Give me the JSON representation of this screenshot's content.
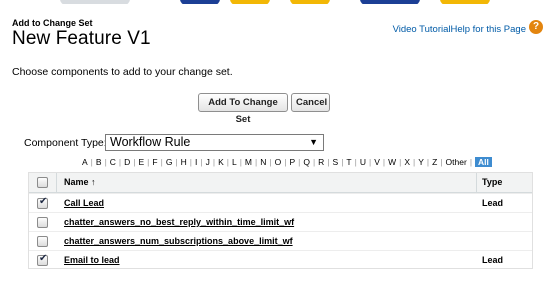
{
  "header": {
    "eyebrow": "Add to Change Set",
    "title": "New Feature V1",
    "video_link": "Video Tutorial",
    "help_link": "Help for this Page"
  },
  "instructions": "Choose components to add to your change set.",
  "buttons": {
    "add_label": "Add To Change Set",
    "cancel_label": "Cancel"
  },
  "filter": {
    "label": "Component Type:",
    "selected": "Workflow Rule",
    "letters": [
      "A",
      "B",
      "C",
      "D",
      "E",
      "F",
      "G",
      "H",
      "I",
      "J",
      "K",
      "L",
      "M",
      "N",
      "O",
      "P",
      "Q",
      "R",
      "S",
      "T",
      "U",
      "V",
      "W",
      "X",
      "Y",
      "Z",
      "Other"
    ],
    "all_label": "All"
  },
  "table": {
    "headers": {
      "name": "Name ↑",
      "type": "Type"
    },
    "rows": [
      {
        "checked": true,
        "name": "Call Lead",
        "type": "Lead"
      },
      {
        "checked": false,
        "name": "chatter_answers_no_best_reply_within_time_limit_wf",
        "type": ""
      },
      {
        "checked": false,
        "name": "chatter_answers_num_subscriptions_above_limit_wf",
        "type": ""
      },
      {
        "checked": true,
        "name": "Email to lead",
        "type": "Lead"
      }
    ]
  },
  "colors": {
    "link": "#015ba7",
    "help_icon": "#e3850f",
    "all_highlight": "#3e8cd0"
  }
}
